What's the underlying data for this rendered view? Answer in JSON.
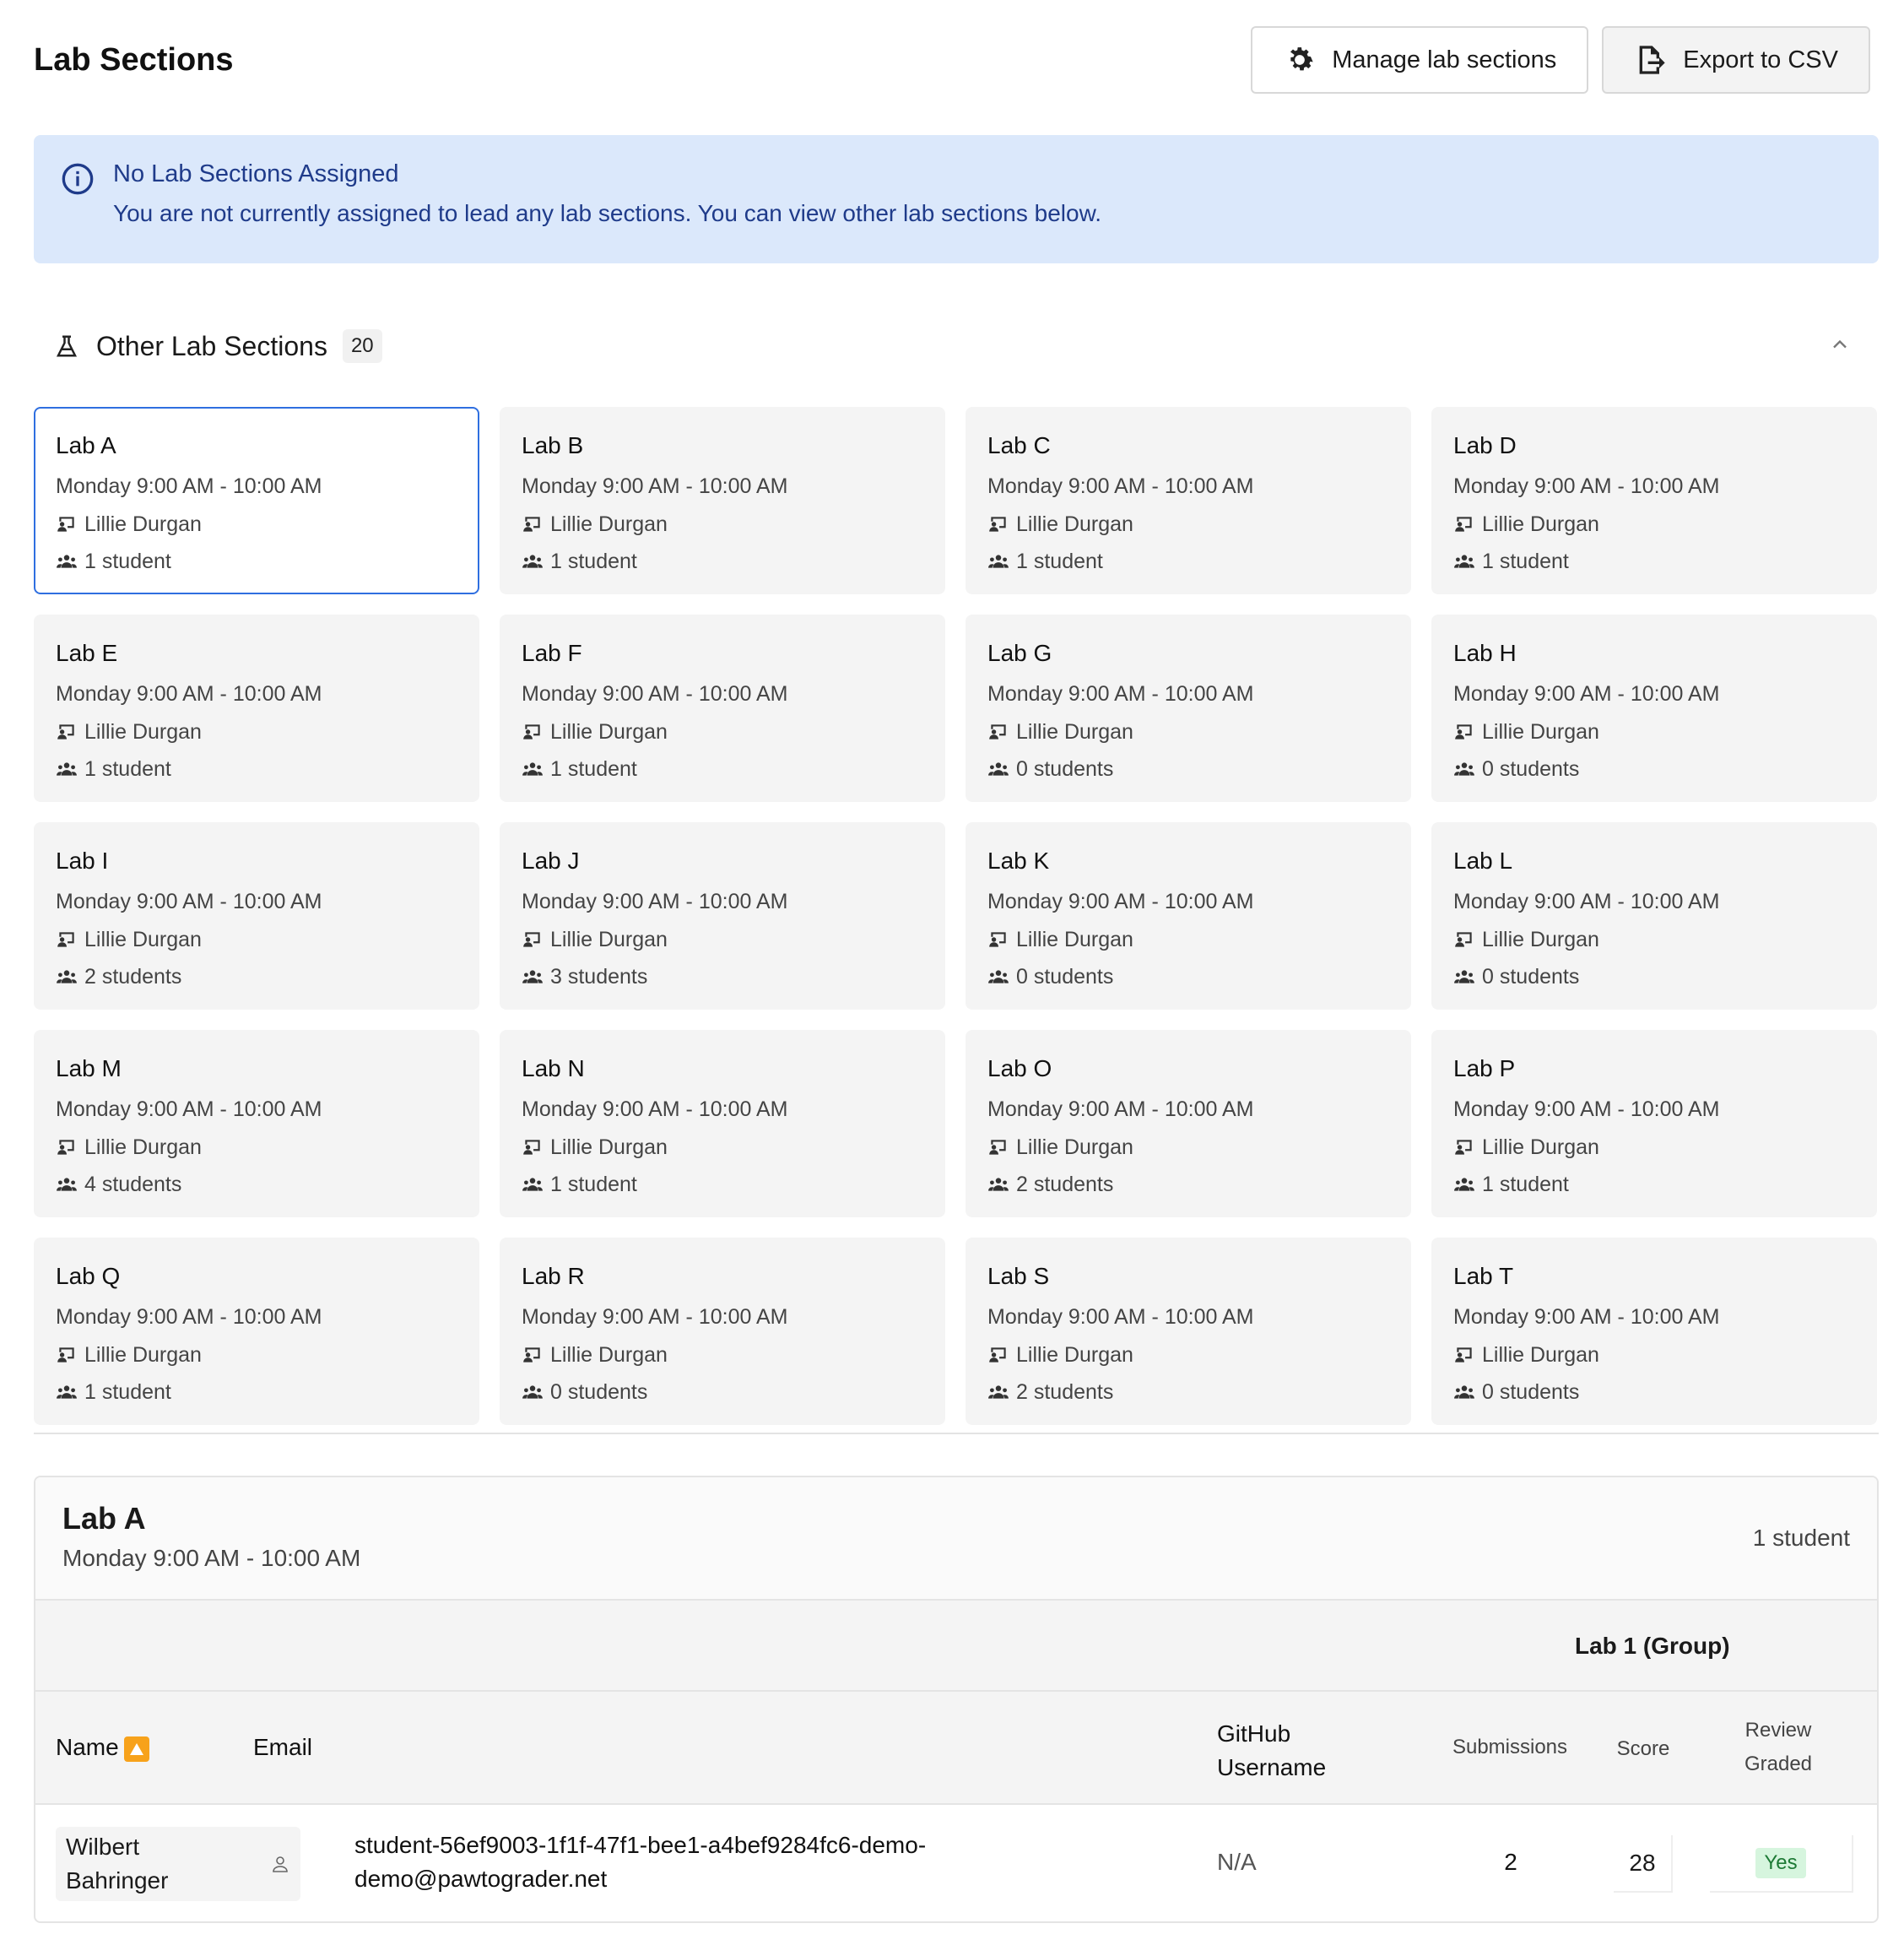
{
  "header": {
    "title": "Lab Sections",
    "manage_label": "Manage lab sections",
    "export_label": "Export to CSV"
  },
  "alert": {
    "title": "No Lab Sections Assigned",
    "message": "You are not currently assigned to lead any lab sections. You can view other lab sections below."
  },
  "section": {
    "title": "Other Lab Sections",
    "count": "20"
  },
  "labs": [
    {
      "name": "Lab A",
      "time": "Monday 9:00 AM - 10:00 AM",
      "leader": "Lillie Durgan",
      "students": "1 student"
    },
    {
      "name": "Lab B",
      "time": "Monday 9:00 AM - 10:00 AM",
      "leader": "Lillie Durgan",
      "students": "1 student"
    },
    {
      "name": "Lab C",
      "time": "Monday 9:00 AM - 10:00 AM",
      "leader": "Lillie Durgan",
      "students": "1 student"
    },
    {
      "name": "Lab D",
      "time": "Monday 9:00 AM - 10:00 AM",
      "leader": "Lillie Durgan",
      "students": "1 student"
    },
    {
      "name": "Lab E",
      "time": "Monday 9:00 AM - 10:00 AM",
      "leader": "Lillie Durgan",
      "students": "1 student"
    },
    {
      "name": "Lab F",
      "time": "Monday 9:00 AM - 10:00 AM",
      "leader": "Lillie Durgan",
      "students": "1 student"
    },
    {
      "name": "Lab G",
      "time": "Monday 9:00 AM - 10:00 AM",
      "leader": "Lillie Durgan",
      "students": "0 students"
    },
    {
      "name": "Lab H",
      "time": "Monday 9:00 AM - 10:00 AM",
      "leader": "Lillie Durgan",
      "students": "0 students"
    },
    {
      "name": "Lab I",
      "time": "Monday 9:00 AM - 10:00 AM",
      "leader": "Lillie Durgan",
      "students": "2 students"
    },
    {
      "name": "Lab J",
      "time": "Monday 9:00 AM - 10:00 AM",
      "leader": "Lillie Durgan",
      "students": "3 students"
    },
    {
      "name": "Lab K",
      "time": "Monday 9:00 AM - 10:00 AM",
      "leader": "Lillie Durgan",
      "students": "0 students"
    },
    {
      "name": "Lab L",
      "time": "Monday 9:00 AM - 10:00 AM",
      "leader": "Lillie Durgan",
      "students": "0 students"
    },
    {
      "name": "Lab M",
      "time": "Monday 9:00 AM - 10:00 AM",
      "leader": "Lillie Durgan",
      "students": "4 students"
    },
    {
      "name": "Lab N",
      "time": "Monday 9:00 AM - 10:00 AM",
      "leader": "Lillie Durgan",
      "students": "1 student"
    },
    {
      "name": "Lab O",
      "time": "Monday 9:00 AM - 10:00 AM",
      "leader": "Lillie Durgan",
      "students": "2 students"
    },
    {
      "name": "Lab P",
      "time": "Monday 9:00 AM - 10:00 AM",
      "leader": "Lillie Durgan",
      "students": "1 student"
    },
    {
      "name": "Lab Q",
      "time": "Monday 9:00 AM - 10:00 AM",
      "leader": "Lillie Durgan",
      "students": "1 student"
    },
    {
      "name": "Lab R",
      "time": "Monday 9:00 AM - 10:00 AM",
      "leader": "Lillie Durgan",
      "students": "0 students"
    },
    {
      "name": "Lab S",
      "time": "Monday 9:00 AM - 10:00 AM",
      "leader": "Lillie Durgan",
      "students": "2 students"
    },
    {
      "name": "Lab T",
      "time": "Monday 9:00 AM - 10:00 AM",
      "leader": "Lillie Durgan",
      "students": "0 students"
    }
  ],
  "detail": {
    "title": "Lab A",
    "time": "Monday 9:00 AM - 10:00 AM",
    "count": "1 student",
    "group_header": "Lab 1 (Group)",
    "columns": {
      "name": "Name",
      "email": "Email",
      "github_line1": "GitHub",
      "github_line2": "Username",
      "submissions": "Submissions",
      "score": "Score",
      "review_line1": "Review",
      "review_line2": "Graded"
    },
    "row": {
      "name_line1": "Wilbert",
      "name_line2": "Bahringer",
      "email_line1": "student-56ef9003-1f1f-47f1-bee1-a4bef9284fc6-demo-",
      "email_line2": "demo@pawtograder.net",
      "github": "N/A",
      "submissions": "2",
      "score": "28",
      "graded": "Yes"
    }
  },
  "colors": {
    "accent": "#2f6fe0",
    "alert_bg": "#dbe8fb",
    "alert_text": "#1f3b8a",
    "badge_green_bg": "#d6f5de",
    "badge_green_text": "#1d7a35"
  }
}
